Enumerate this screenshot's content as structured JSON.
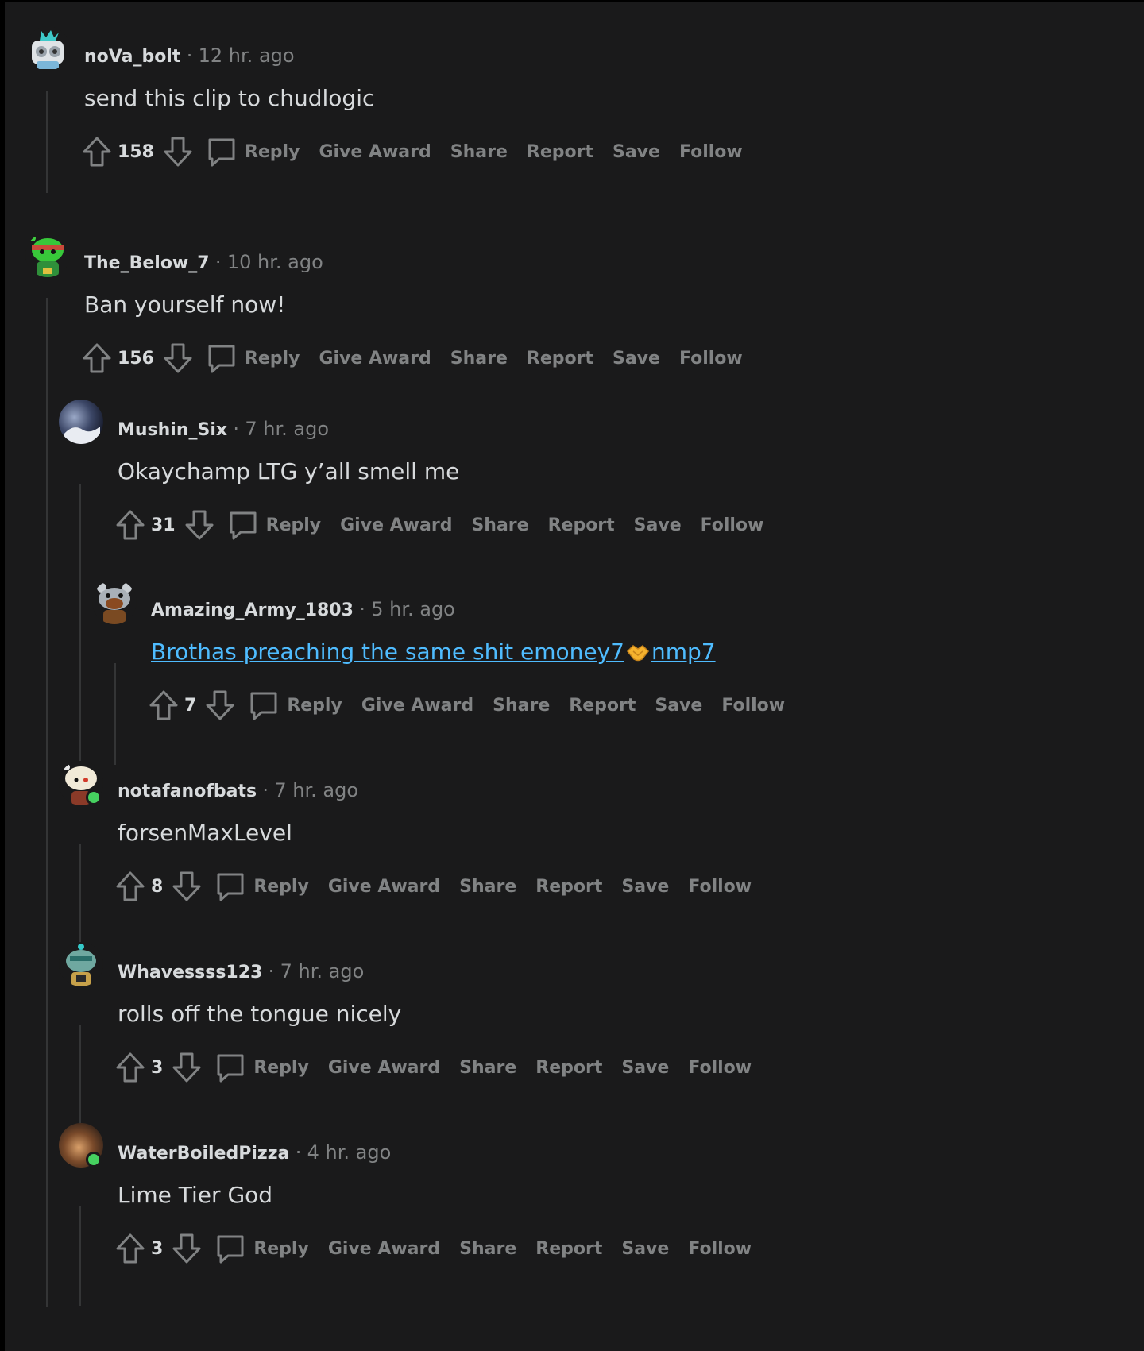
{
  "comments": [
    {
      "username": "noVa_bolt",
      "time": "12 hr. ago",
      "body": "send this clip to chudlogic",
      "score": "158",
      "actions": [
        "Reply",
        "Give Award",
        "Share",
        "Report",
        "Save",
        "Follow"
      ]
    },
    {
      "username": "The_Below_7",
      "time": "10 hr. ago",
      "body": "Ban yourself now!",
      "score": "156",
      "actions": [
        "Reply",
        "Give Award",
        "Share",
        "Report",
        "Save",
        "Follow"
      ]
    },
    {
      "username": "Mushin_Six",
      "time": "7 hr. ago",
      "body": "Okaychamp LTG y’all smell me",
      "score": "31",
      "actions": [
        "Reply",
        "Give Award",
        "Share",
        "Report",
        "Save",
        "Follow"
      ]
    },
    {
      "username": "Amazing_Army_1803",
      "time": "5 hr. ago",
      "body_part1": "Brothas preaching the same shit emoney7",
      "body_part2": "nmp7",
      "score": "7",
      "actions": [
        "Reply",
        "Give Award",
        "Share",
        "Report",
        "Save",
        "Follow"
      ]
    },
    {
      "username": "notafanofbats",
      "time": "7 hr. ago",
      "body": "forsenMaxLevel",
      "score": "8",
      "actions": [
        "Reply",
        "Give Award",
        "Share",
        "Report",
        "Save",
        "Follow"
      ]
    },
    {
      "username": "Whavessss123",
      "time": "7 hr. ago",
      "body": "rolls off the tongue nicely",
      "score": "3",
      "actions": [
        "Reply",
        "Give Award",
        "Share",
        "Report",
        "Save",
        "Follow"
      ]
    },
    {
      "username": "WaterBoiledPizza",
      "time": "4 hr. ago",
      "body": "Lime Tier God",
      "score": "3",
      "actions": [
        "Reply",
        "Give Award",
        "Share",
        "Report",
        "Save",
        "Follow"
      ]
    }
  ],
  "separator": "·",
  "colors": {
    "background": "#1a1a1b",
    "text": "#d7dadc",
    "muted": "#818384",
    "link": "#4fbcff",
    "online": "#46d160",
    "thread_line": "#343536"
  }
}
